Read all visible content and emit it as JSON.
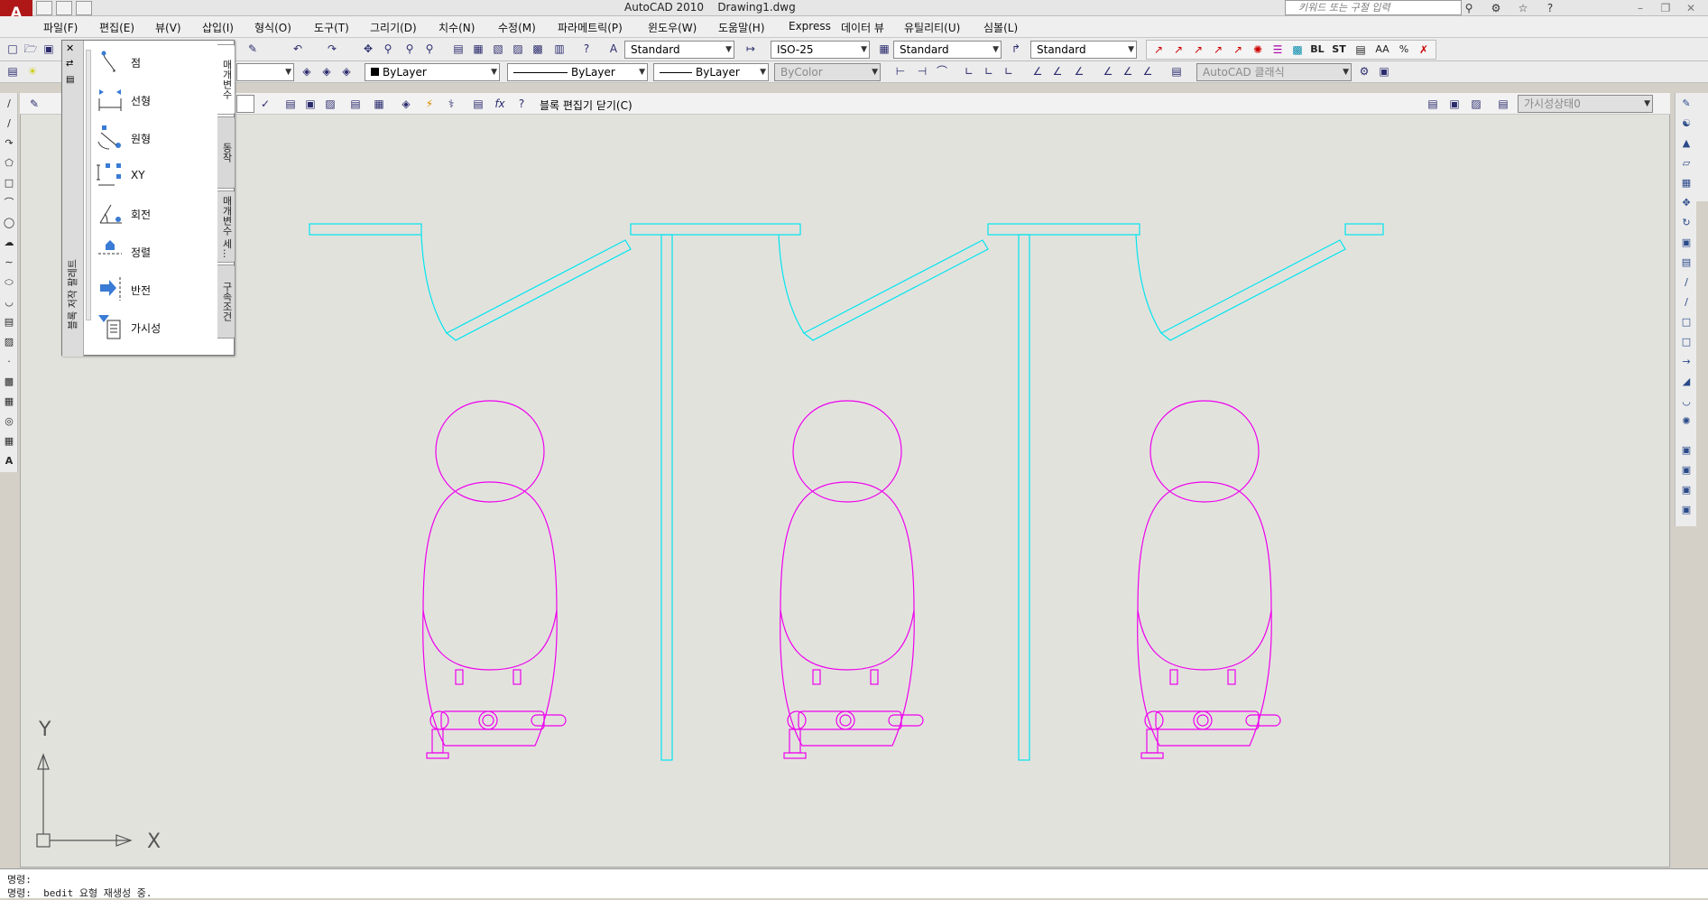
{
  "window": {
    "title_app": "AutoCAD 2010",
    "title_file": "Drawing1.dwg",
    "search_placeholder": "키워드 또는 구절 입력"
  },
  "menubar": {
    "items": [
      "파일(F)",
      "편집(E)",
      "뷰(V)",
      "삽입(I)",
      "형식(O)",
      "도구(T)",
      "그리기(D)",
      "치수(N)",
      "수정(M)",
      "파라메트릭(P)",
      "윈도우(W)",
      "도움말(H)",
      "Express",
      "데이터 뷰",
      "유틸리티(U)",
      "심볼(L)"
    ]
  },
  "toolbar_styles": {
    "text_style": "Standard",
    "dim_style": "ISO-25",
    "table_style": "Standard",
    "mleader_style": "Standard"
  },
  "toolbar_properties": {
    "color": "ByLayer",
    "linetype": "ByLayer",
    "lineweight": "ByLayer",
    "plotstyle": "ByColor",
    "workspace": "AutoCAD 클래식"
  },
  "block_editor": {
    "close_label": "블록 편집기 닫기(C)",
    "visibility_state": "가시성상태0"
  },
  "palette": {
    "side_title": "블록 저작 팔레트",
    "items": [
      {
        "label": "점",
        "icon": "point-param-icon"
      },
      {
        "label": "선형",
        "icon": "linear-param-icon"
      },
      {
        "label": "원형",
        "icon": "polar-param-icon"
      },
      {
        "label": "XY",
        "icon": "xy-param-icon"
      },
      {
        "label": "회전",
        "icon": "rotation-param-icon"
      },
      {
        "label": "정렬",
        "icon": "alignment-param-icon"
      },
      {
        "label": "반전",
        "icon": "flip-param-icon"
      },
      {
        "label": "가시성",
        "icon": "visibility-param-icon"
      }
    ],
    "tabs": [
      "매개변수",
      "동작",
      "매개변수 세...",
      "구속조건"
    ]
  },
  "ucs": {
    "x_label": "X",
    "y_label": "Y"
  },
  "command_line": {
    "line1": "명령:",
    "line2": "명령:  bedit 요형 재생성 중."
  },
  "colors": {
    "canvas_bg": "#e2e2dd",
    "partition": "#00e5ee",
    "urinal": "#ee00ee",
    "app_red": "#b01818"
  }
}
